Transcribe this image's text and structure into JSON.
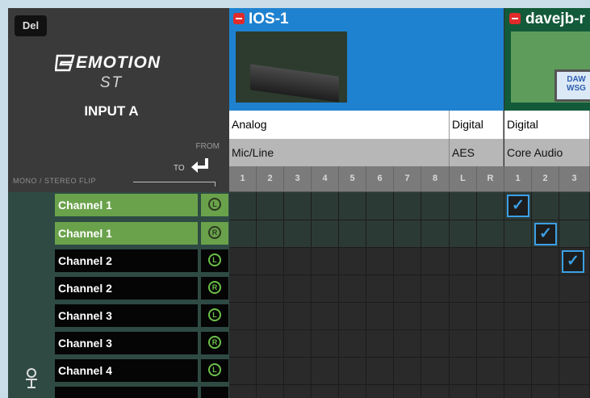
{
  "left_panel": {
    "del_label": "Del",
    "logo_main": "EMOTION",
    "logo_sub": "ST",
    "title": "INPUT A",
    "from_label": "FROM",
    "to_label": "TO",
    "flip_label": "MONO / STEREO FLIP",
    "channels": [
      {
        "label": "Channel 1",
        "side": "L",
        "selected": true
      },
      {
        "label": "Channel 1",
        "side": "R",
        "selected": true
      },
      {
        "label": "Channel 2",
        "side": "L",
        "selected": false
      },
      {
        "label": "Channel 2",
        "side": "R",
        "selected": false
      },
      {
        "label": "Channel 3",
        "side": "L",
        "selected": false
      },
      {
        "label": "Channel 3",
        "side": "R",
        "selected": false
      },
      {
        "label": "Channel 4",
        "side": "L",
        "selected": false
      }
    ]
  },
  "devices": [
    {
      "name": "IOS-1",
      "image_alt": "audio interface"
    },
    {
      "name": "davejb-r",
      "image_alt": "DAW WSG"
    }
  ],
  "device2_screen_text": "DAW WSG",
  "groups": {
    "analog": {
      "type": "Analog",
      "sub": "Mic/Line"
    },
    "digital_aes": {
      "type": "Digital",
      "sub": "AES"
    },
    "digital_core": {
      "type": "Digital",
      "sub": "Core Audio"
    }
  },
  "column_numbers": [
    "1",
    "2",
    "3",
    "4",
    "5",
    "6",
    "7",
    "8",
    "L",
    "R",
    "1",
    "2",
    "3"
  ],
  "checkmark": "✓",
  "colors": {
    "selected_green": "#6aa24b",
    "device1_blue": "#1f82d0",
    "device2_green": "#125a39",
    "check_blue": "#3ba0e6"
  }
}
